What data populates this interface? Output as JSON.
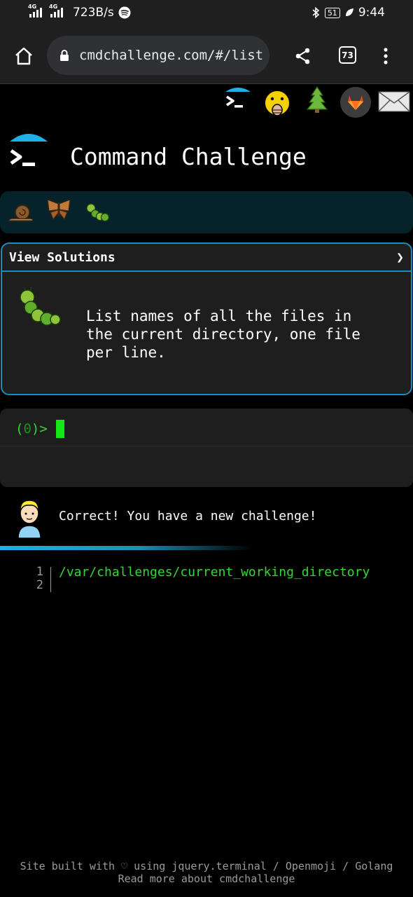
{
  "status_bar": {
    "network_left": "4G",
    "network_right": "4G",
    "speed": "723B/s",
    "battery": "51",
    "time": "9:44"
  },
  "browser": {
    "url": "cmdchallenge.com/#/list",
    "tab_count": "73"
  },
  "site": {
    "title": "Command Challenge"
  },
  "challenge": {
    "view_solutions_label": "View Solutions",
    "chevron": "❯",
    "description": "List names of all the files in\nthe current directory, one file\nper line."
  },
  "terminal": {
    "prompt_open": "(",
    "prompt_code": "0",
    "prompt_close": ")>"
  },
  "result": {
    "message": "Correct! You have a new challenge!"
  },
  "output": {
    "lines": [
      {
        "num": "1",
        "text": "/var/challenges/current_working_directory"
      },
      {
        "num": "2",
        "text": ""
      }
    ]
  },
  "footer": {
    "line1": "Site built with ♡ using jquery.terminal / Openmoji / Golang",
    "line2": "Read more about cmdchallenge"
  },
  "colors": {
    "accent_blue": "#1d8cba",
    "terminal_green": "#33d633",
    "levels_bg": "#06232b"
  }
}
